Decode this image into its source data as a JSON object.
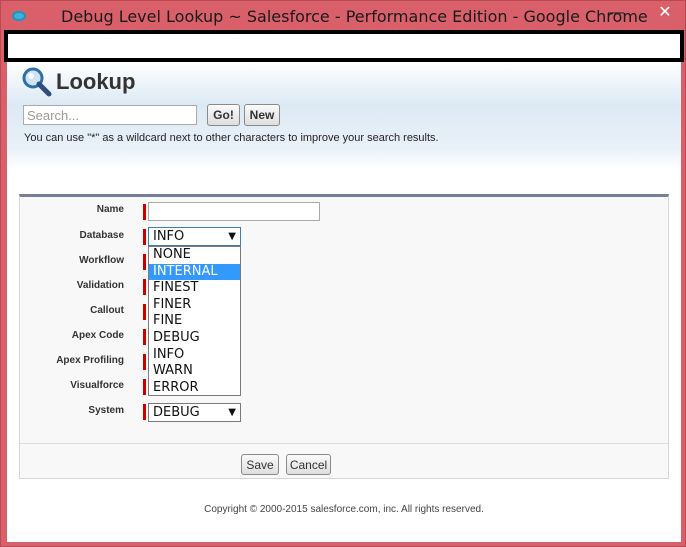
{
  "window": {
    "title": "Debug Level Lookup ~ Salesforce - Performance Edition - Google Chrome",
    "minimize_glyph": "—",
    "close_glyph": "✕"
  },
  "page": {
    "title": "Lookup",
    "search": {
      "placeholder": "Search...",
      "value": ""
    },
    "go_label": "Go!",
    "new_label": "New",
    "hint": "You can use \"*\" as a wildcard next to other characters to improve your search results."
  },
  "form": {
    "fields": [
      {
        "label": "Name"
      },
      {
        "label": "Database",
        "value": "INFO"
      },
      {
        "label": "Workflow"
      },
      {
        "label": "Validation"
      },
      {
        "label": "Callout"
      },
      {
        "label": "Apex Code"
      },
      {
        "label": "Apex Profiling"
      },
      {
        "label": "Visualforce"
      },
      {
        "label": "System",
        "value": "DEBUG"
      }
    ],
    "dropdown_options": [
      "NONE",
      "INTERNAL",
      "FINEST",
      "FINER",
      "FINE",
      "DEBUG",
      "INFO",
      "WARN",
      "ERROR"
    ],
    "highlighted_option": "INTERNAL",
    "save_label": "Save",
    "cancel_label": "Cancel"
  },
  "footer": {
    "copyright": "Copyright © 2000-2015 salesforce.com, inc. All rights reserved."
  },
  "colors": {
    "window_frame": "#d9606a",
    "panel_top_border": "#747e96",
    "required": "#cc0000",
    "selection": "#3399ff"
  }
}
